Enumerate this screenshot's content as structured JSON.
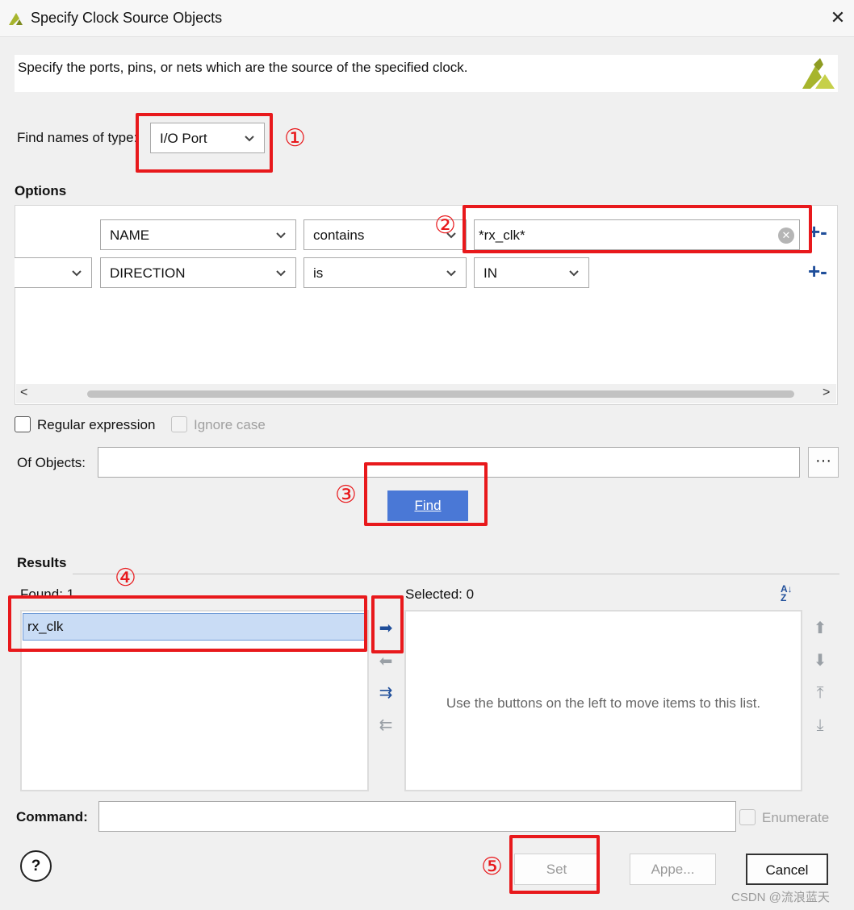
{
  "window": {
    "title": "Specify Clock Source Objects"
  },
  "banner": {
    "text": "Specify the ports, pins, or nets which are the source of the specified clock."
  },
  "find_type": {
    "label": "Find names of type:",
    "value": "I/O Port"
  },
  "options": {
    "title": "Options",
    "row1": {
      "property": "NAME",
      "operator": "contains",
      "value": "*rx_clk*"
    },
    "row2": {
      "property": "DIRECTION",
      "operator": "is",
      "value": "IN"
    }
  },
  "regex": {
    "label": "Regular expression",
    "checked": false
  },
  "ignore_case": {
    "label": "Ignore case",
    "checked": false
  },
  "of_objects": {
    "label": "Of Objects:",
    "value": "",
    "browse_label": "···"
  },
  "find_button": {
    "label": "Find"
  },
  "results": {
    "title": "Results",
    "found_label": "Found: 1",
    "found_items": [
      "rx_clk"
    ],
    "selected_label": "Selected: 0",
    "selected_placeholder": "Use the buttons on the left to move items to this list."
  },
  "command": {
    "label": "Command:",
    "value": ""
  },
  "enumerate": {
    "label": "Enumerate",
    "checked": false
  },
  "buttons": {
    "help": "?",
    "set": "Set",
    "append": "Appe...",
    "cancel": "Cancel"
  },
  "annotations": [
    "①",
    "②",
    "③",
    "④",
    "⑤"
  ],
  "watermark": "CSDN @流浪蓝天",
  "colors": {
    "accent": "#4a78d6",
    "annotation": "#e8191c",
    "selection": "#c9dcf5",
    "logo": "#a7b52d"
  }
}
